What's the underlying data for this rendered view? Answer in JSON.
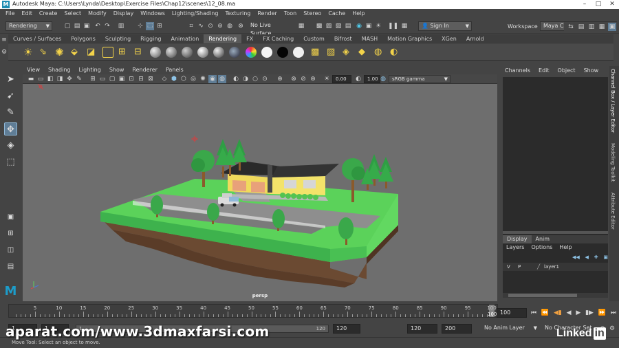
{
  "app": {
    "title": "Autodesk Maya: C:\\Users\\Lynda\\Desktop\\Exercise Files\\Chap12\\scenes\\12_08.ma",
    "logo_letter": "M"
  },
  "window_controls": {
    "minimize": "–",
    "maximize": "□",
    "close": "✕"
  },
  "menubar": [
    "File",
    "Edit",
    "Create",
    "Select",
    "Modify",
    "Display",
    "Windows",
    "Lighting/Shading",
    "Texturing",
    "Render",
    "Toon",
    "Stereo",
    "Cache",
    "Help"
  ],
  "statusline": {
    "menuset": "Rendering",
    "live_surface": "No Live Surface",
    "sign_in": "Sign In",
    "workspace_label": "Workspace :",
    "workspace_value": "Maya Classic"
  },
  "shelf_tabs": [
    "Curves / Surfaces",
    "Polygons",
    "Sculpting",
    "Rigging",
    "Animation",
    "Rendering",
    "FX",
    "FX Caching",
    "Custom",
    "Bifrost",
    "MASH",
    "Motion Graphics",
    "XGen",
    "Arnold"
  ],
  "shelf_active": "Rendering",
  "viewport": {
    "menu": [
      "View",
      "Shading",
      "Lighting",
      "Show",
      "Renderer",
      "Panels"
    ],
    "exposure": "0.00",
    "gamma": "1.00",
    "color_space": "sRGB gamma",
    "camera_label": "persp"
  },
  "channel_box": {
    "menu": [
      "Channels",
      "Edit",
      "Object",
      "Show"
    ]
  },
  "layer_editor": {
    "tabs": [
      "Display",
      "Anim"
    ],
    "menu": [
      "Layers",
      "Options",
      "Help"
    ],
    "layer": {
      "v": "V",
      "p": "P",
      "name": "layer1"
    }
  },
  "side_tabs": [
    "Channel Box / Layer Editor",
    "Modeling Toolkit",
    "Attribute Editor"
  ],
  "timeline": {
    "ticks": [
      5,
      10,
      15,
      20,
      25,
      30,
      35,
      40,
      45,
      50,
      55,
      60,
      65,
      70,
      75,
      80,
      85,
      90,
      95,
      100
    ],
    "current_frame_marker": "100",
    "current_frame_field": "100"
  },
  "range": {
    "start": "1",
    "inner_start": "1",
    "inner_end": "120",
    "end": "120",
    "end_field": "120",
    "max_field": "200",
    "anim_layer": "No Anim Layer",
    "character_set": "No Character Set"
  },
  "helpline": "Move Tool: Select an object to move.",
  "watermark": "aparat.com/www.3dmaxfarsi.com",
  "linkedin": {
    "text": "Linked",
    "badge": "in"
  },
  "colors": {
    "maya_blue": "#1d8cb2",
    "viewport_bg": "#6e6e6e",
    "grass": "#5cd25a",
    "dirt": "#6b4a32",
    "house_yellow": "#f1e36a",
    "roof": "#2a2a2a",
    "tree": "#3aa84a"
  }
}
